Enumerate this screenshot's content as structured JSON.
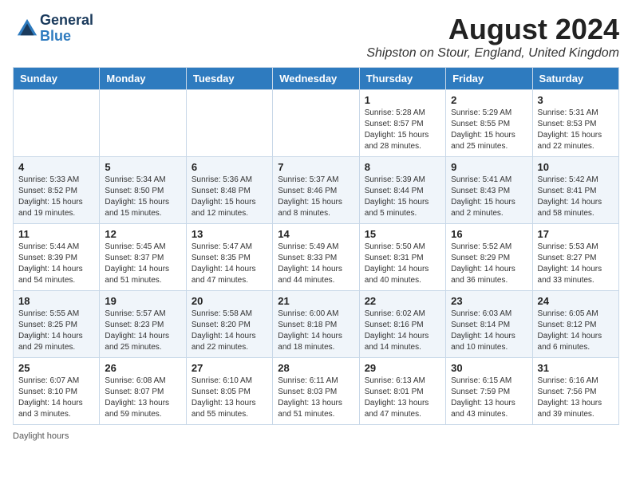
{
  "logo": {
    "general": "General",
    "blue": "Blue"
  },
  "header": {
    "month_year": "August 2024",
    "location": "Shipston on Stour, England, United Kingdom"
  },
  "days_of_week": [
    "Sunday",
    "Monday",
    "Tuesday",
    "Wednesday",
    "Thursday",
    "Friday",
    "Saturday"
  ],
  "footer": {
    "note": "Daylight hours"
  },
  "weeks": [
    [
      {
        "day": "",
        "info": ""
      },
      {
        "day": "",
        "info": ""
      },
      {
        "day": "",
        "info": ""
      },
      {
        "day": "",
        "info": ""
      },
      {
        "day": "1",
        "info": "Sunrise: 5:28 AM\nSunset: 8:57 PM\nDaylight: 15 hours\nand 28 minutes."
      },
      {
        "day": "2",
        "info": "Sunrise: 5:29 AM\nSunset: 8:55 PM\nDaylight: 15 hours\nand 25 minutes."
      },
      {
        "day": "3",
        "info": "Sunrise: 5:31 AM\nSunset: 8:53 PM\nDaylight: 15 hours\nand 22 minutes."
      }
    ],
    [
      {
        "day": "4",
        "info": "Sunrise: 5:33 AM\nSunset: 8:52 PM\nDaylight: 15 hours\nand 19 minutes."
      },
      {
        "day": "5",
        "info": "Sunrise: 5:34 AM\nSunset: 8:50 PM\nDaylight: 15 hours\nand 15 minutes."
      },
      {
        "day": "6",
        "info": "Sunrise: 5:36 AM\nSunset: 8:48 PM\nDaylight: 15 hours\nand 12 minutes."
      },
      {
        "day": "7",
        "info": "Sunrise: 5:37 AM\nSunset: 8:46 PM\nDaylight: 15 hours\nand 8 minutes."
      },
      {
        "day": "8",
        "info": "Sunrise: 5:39 AM\nSunset: 8:44 PM\nDaylight: 15 hours\nand 5 minutes."
      },
      {
        "day": "9",
        "info": "Sunrise: 5:41 AM\nSunset: 8:43 PM\nDaylight: 15 hours\nand 2 minutes."
      },
      {
        "day": "10",
        "info": "Sunrise: 5:42 AM\nSunset: 8:41 PM\nDaylight: 14 hours\nand 58 minutes."
      }
    ],
    [
      {
        "day": "11",
        "info": "Sunrise: 5:44 AM\nSunset: 8:39 PM\nDaylight: 14 hours\nand 54 minutes."
      },
      {
        "day": "12",
        "info": "Sunrise: 5:45 AM\nSunset: 8:37 PM\nDaylight: 14 hours\nand 51 minutes."
      },
      {
        "day": "13",
        "info": "Sunrise: 5:47 AM\nSunset: 8:35 PM\nDaylight: 14 hours\nand 47 minutes."
      },
      {
        "day": "14",
        "info": "Sunrise: 5:49 AM\nSunset: 8:33 PM\nDaylight: 14 hours\nand 44 minutes."
      },
      {
        "day": "15",
        "info": "Sunrise: 5:50 AM\nSunset: 8:31 PM\nDaylight: 14 hours\nand 40 minutes."
      },
      {
        "day": "16",
        "info": "Sunrise: 5:52 AM\nSunset: 8:29 PM\nDaylight: 14 hours\nand 36 minutes."
      },
      {
        "day": "17",
        "info": "Sunrise: 5:53 AM\nSunset: 8:27 PM\nDaylight: 14 hours\nand 33 minutes."
      }
    ],
    [
      {
        "day": "18",
        "info": "Sunrise: 5:55 AM\nSunset: 8:25 PM\nDaylight: 14 hours\nand 29 minutes."
      },
      {
        "day": "19",
        "info": "Sunrise: 5:57 AM\nSunset: 8:23 PM\nDaylight: 14 hours\nand 25 minutes."
      },
      {
        "day": "20",
        "info": "Sunrise: 5:58 AM\nSunset: 8:20 PM\nDaylight: 14 hours\nand 22 minutes."
      },
      {
        "day": "21",
        "info": "Sunrise: 6:00 AM\nSunset: 8:18 PM\nDaylight: 14 hours\nand 18 minutes."
      },
      {
        "day": "22",
        "info": "Sunrise: 6:02 AM\nSunset: 8:16 PM\nDaylight: 14 hours\nand 14 minutes."
      },
      {
        "day": "23",
        "info": "Sunrise: 6:03 AM\nSunset: 8:14 PM\nDaylight: 14 hours\nand 10 minutes."
      },
      {
        "day": "24",
        "info": "Sunrise: 6:05 AM\nSunset: 8:12 PM\nDaylight: 14 hours\nand 6 minutes."
      }
    ],
    [
      {
        "day": "25",
        "info": "Sunrise: 6:07 AM\nSunset: 8:10 PM\nDaylight: 14 hours\nand 3 minutes."
      },
      {
        "day": "26",
        "info": "Sunrise: 6:08 AM\nSunset: 8:07 PM\nDaylight: 13 hours\nand 59 minutes."
      },
      {
        "day": "27",
        "info": "Sunrise: 6:10 AM\nSunset: 8:05 PM\nDaylight: 13 hours\nand 55 minutes."
      },
      {
        "day": "28",
        "info": "Sunrise: 6:11 AM\nSunset: 8:03 PM\nDaylight: 13 hours\nand 51 minutes."
      },
      {
        "day": "29",
        "info": "Sunrise: 6:13 AM\nSunset: 8:01 PM\nDaylight: 13 hours\nand 47 minutes."
      },
      {
        "day": "30",
        "info": "Sunrise: 6:15 AM\nSunset: 7:59 PM\nDaylight: 13 hours\nand 43 minutes."
      },
      {
        "day": "31",
        "info": "Sunrise: 6:16 AM\nSunset: 7:56 PM\nDaylight: 13 hours\nand 39 minutes."
      }
    ]
  ]
}
